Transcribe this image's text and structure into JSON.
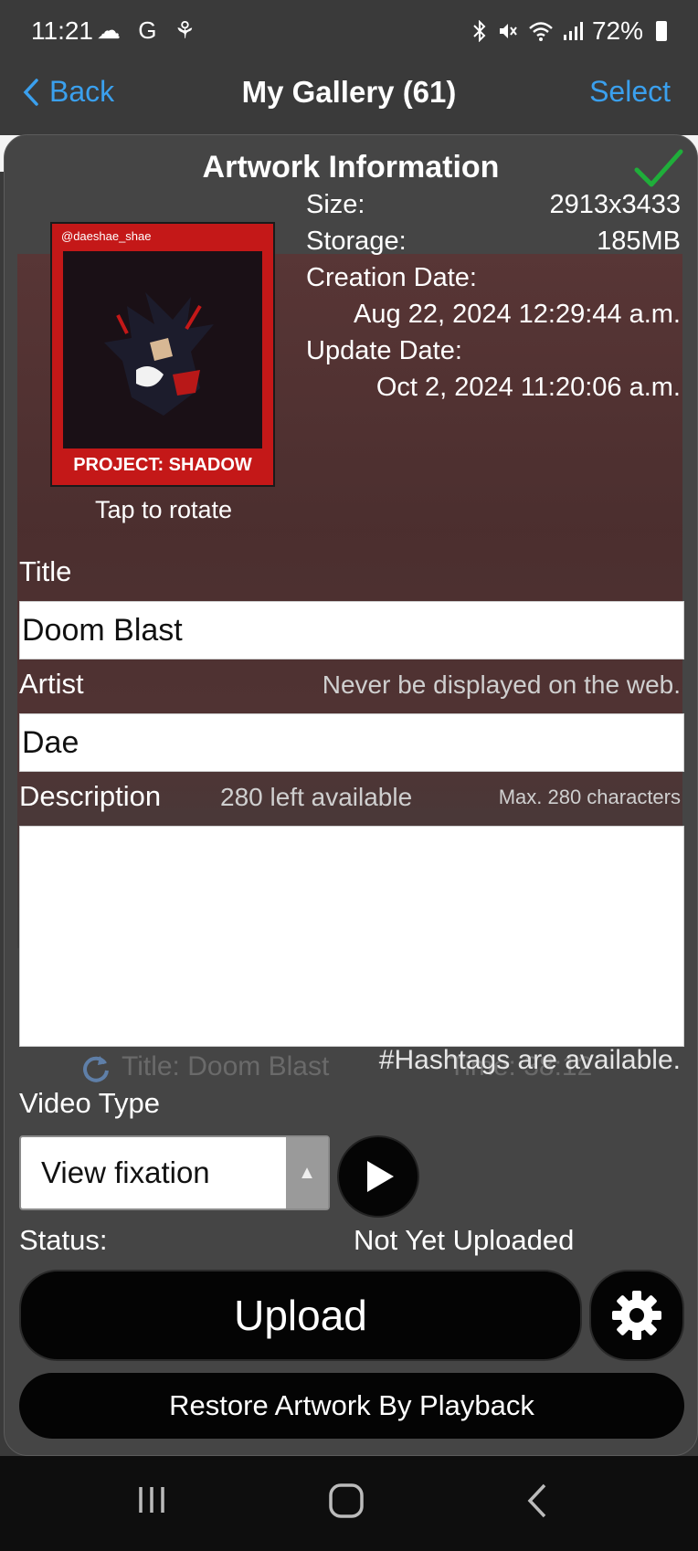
{
  "status_bar": {
    "time": "11:21",
    "left_icons": "☁ G ⚘",
    "battery": "72%"
  },
  "nav": {
    "back_label": "Back",
    "title": "My Gallery (61)",
    "select_label": "Select"
  },
  "panel": {
    "title": "Artwork Information",
    "thumbnail": {
      "handle": "@daeshae_shae",
      "caption": "PROJECT: SHADOW"
    },
    "rotate_hint": "Tap to rotate",
    "info": {
      "size_label": "Size:",
      "size_value": "2913x3433",
      "storage_label": "Storage:",
      "storage_value": "185MB",
      "creation_label": "Creation Date:",
      "creation_value": "Aug 22, 2024 12:29:44 a.m.",
      "update_label": "Update Date:",
      "update_value": "Oct 2, 2024 11:20:06 a.m."
    },
    "title_field": {
      "label": "Title",
      "value": "Doom Blast"
    },
    "artist_field": {
      "label": "Artist",
      "hint": "Never be displayed on the web.",
      "value": "Dae"
    },
    "description_field": {
      "label": "Description",
      "remaining": "280 left available",
      "max": "Max. 280 characters",
      "value": "",
      "hashtag_hint": "#Hashtags are available."
    },
    "ghost": {
      "title": "Title: Doom Blast",
      "time": "Time:   38:12"
    },
    "video_type": {
      "label": "Video Type",
      "selected": "View fixation"
    },
    "status": {
      "label": "Status:",
      "value": "Not Yet Uploaded"
    },
    "upload_label": "Upload",
    "restore_label": "Restore Artwork By Playback"
  },
  "colors": {
    "accent": "#3aa0ee",
    "check": "#1fae3a",
    "panel": "#454545"
  }
}
